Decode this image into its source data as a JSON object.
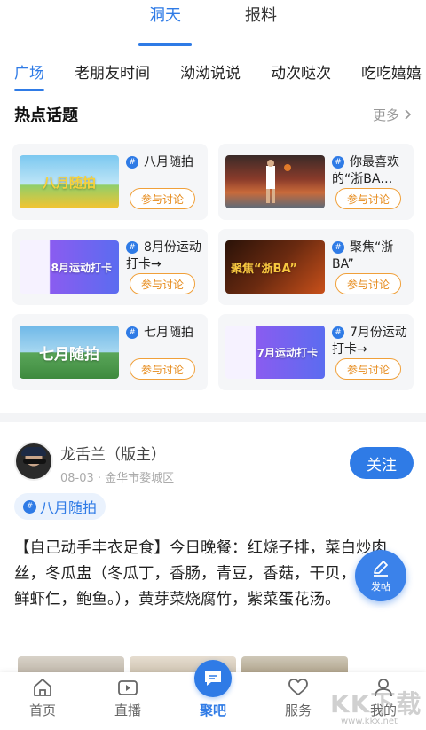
{
  "top_tabs": [
    {
      "label": "洞天",
      "active": true
    },
    {
      "label": "报料",
      "active": false
    }
  ],
  "categories": [
    {
      "label": "广场",
      "active": true
    },
    {
      "label": "老朋友时间",
      "active": false
    },
    {
      "label": "泑泑说说",
      "active": false
    },
    {
      "label": "动次哒次",
      "active": false
    },
    {
      "label": "吃吃嬉嬉",
      "active": false
    }
  ],
  "hot_topics": {
    "title": "热点话题",
    "more_label": "更多",
    "join_label": "参与讨论",
    "items": [
      {
        "name": "八月随拍",
        "thumb_text": "八月随拍"
      },
      {
        "name": "你最喜欢的“浙BA…",
        "thumb_text": ""
      },
      {
        "name": "8月份运动打卡→",
        "thumb_text": "8月运动打卡"
      },
      {
        "name": "聚焦“浙BA”",
        "thumb_text": "聚焦“浙BA”"
      },
      {
        "name": "七月随拍",
        "thumb_text": "七月随拍"
      },
      {
        "name": "7月份运动打卡→",
        "thumb_text": "7月运动打卡"
      }
    ]
  },
  "post": {
    "author": "龙舌兰（版主）",
    "meta": "08-03 · 金华市婺城区",
    "follow_label": "关注",
    "tag": "八月随拍",
    "content": "【自己动手丰衣足食】今日晚餐：红烧子排，菜白炒肉丝，冬瓜盅（冬瓜丁，香肠，青豆，香菇，干贝，开洋，鲜虾仁，鲍鱼。），黄芽菜烧腐竹，紫菜蛋花汤。"
  },
  "fab": {
    "label": "发帖",
    "icon": "edit-icon"
  },
  "bottom_nav": [
    {
      "label": "首页",
      "icon": "home-icon",
      "active": false
    },
    {
      "label": "直播",
      "icon": "video-icon",
      "active": false
    },
    {
      "label": "聚吧",
      "icon": "chat-bubble-icon",
      "active": true
    },
    {
      "label": "服务",
      "icon": "heart-icon",
      "active": false
    },
    {
      "label": "我的",
      "icon": "user-icon",
      "active": false
    }
  ],
  "watermark": {
    "text": "KK下载",
    "url": "www.kkx.net"
  },
  "colors": {
    "accent": "#2f7be6",
    "join_border": "#f0a03a",
    "card_bg": "#f5f6f8"
  }
}
